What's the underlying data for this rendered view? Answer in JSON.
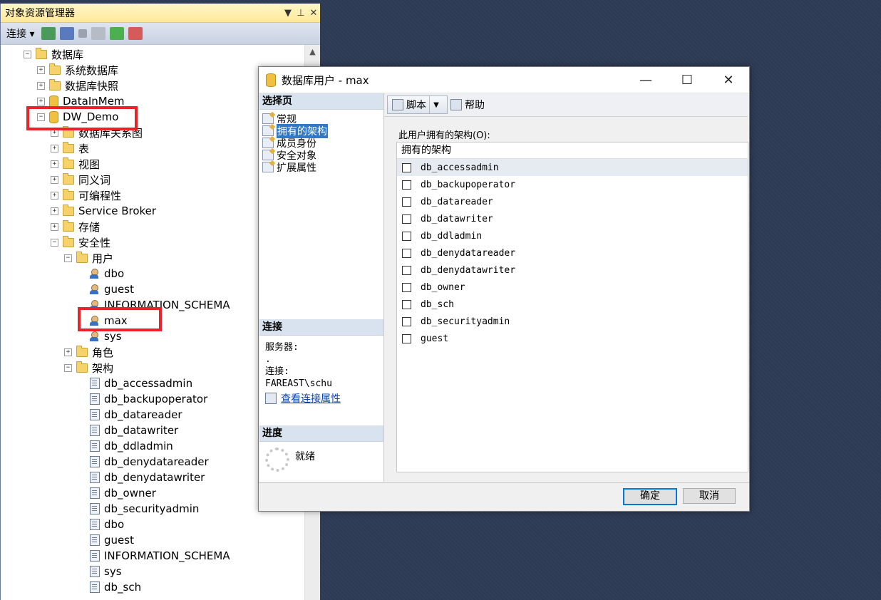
{
  "object_explorer": {
    "title": "对象资源管理器",
    "title_buttons": [
      "▼",
      "⊥",
      "✕"
    ],
    "toolbar": {
      "connect_label": "连接 ▾"
    },
    "tree": [
      {
        "label": "数据库",
        "level": 0,
        "expander": "−",
        "icon": "folder"
      },
      {
        "label": "系统数据库",
        "level": 1,
        "expander": "+",
        "icon": "folder"
      },
      {
        "label": "数据库快照",
        "level": 1,
        "expander": "+",
        "icon": "folder"
      },
      {
        "label": "DataInMem",
        "level": 1,
        "expander": "+",
        "icon": "database"
      },
      {
        "label": "DW_Demo",
        "level": 1,
        "expander": "−",
        "icon": "database"
      },
      {
        "label": "数据库关系图",
        "level": 2,
        "expander": "+",
        "icon": "folder"
      },
      {
        "label": "表",
        "level": 2,
        "expander": "+",
        "icon": "folder"
      },
      {
        "label": "视图",
        "level": 2,
        "expander": "+",
        "icon": "folder"
      },
      {
        "label": "同义词",
        "level": 2,
        "expander": "+",
        "icon": "folder"
      },
      {
        "label": "可编程性",
        "level": 2,
        "expander": "+",
        "icon": "folder"
      },
      {
        "label": "Service Broker",
        "level": 2,
        "expander": "+",
        "icon": "folder"
      },
      {
        "label": "存储",
        "level": 2,
        "expander": "+",
        "icon": "folder"
      },
      {
        "label": "安全性",
        "level": 2,
        "expander": "−",
        "icon": "folder"
      },
      {
        "label": "用户",
        "level": 3,
        "expander": "−",
        "icon": "folder"
      },
      {
        "label": "dbo",
        "level": 4,
        "expander": "",
        "icon": "user"
      },
      {
        "label": "guest",
        "level": 4,
        "expander": "",
        "icon": "user"
      },
      {
        "label": "INFORMATION_SCHEMA",
        "level": 4,
        "expander": "",
        "icon": "user"
      },
      {
        "label": "max",
        "level": 4,
        "expander": "",
        "icon": "user"
      },
      {
        "label": "sys",
        "level": 4,
        "expander": "",
        "icon": "user"
      },
      {
        "label": "角色",
        "level": 3,
        "expander": "+",
        "icon": "folder"
      },
      {
        "label": "架构",
        "level": 3,
        "expander": "−",
        "icon": "folder"
      },
      {
        "label": "db_accessadmin",
        "level": 4,
        "expander": "",
        "icon": "schema"
      },
      {
        "label": "db_backupoperator",
        "level": 4,
        "expander": "",
        "icon": "schema"
      },
      {
        "label": "db_datareader",
        "level": 4,
        "expander": "",
        "icon": "schema"
      },
      {
        "label": "db_datawriter",
        "level": 4,
        "expander": "",
        "icon": "schema"
      },
      {
        "label": "db_ddladmin",
        "level": 4,
        "expander": "",
        "icon": "schema"
      },
      {
        "label": "db_denydatareader",
        "level": 4,
        "expander": "",
        "icon": "schema"
      },
      {
        "label": "db_denydatawriter",
        "level": 4,
        "expander": "",
        "icon": "schema"
      },
      {
        "label": "db_owner",
        "level": 4,
        "expander": "",
        "icon": "schema"
      },
      {
        "label": "db_securityadmin",
        "level": 4,
        "expander": "",
        "icon": "schema"
      },
      {
        "label": "dbo",
        "level": 4,
        "expander": "",
        "icon": "schema"
      },
      {
        "label": "guest",
        "level": 4,
        "expander": "",
        "icon": "schema"
      },
      {
        "label": "INFORMATION_SCHEMA",
        "level": 4,
        "expander": "",
        "icon": "schema"
      },
      {
        "label": "sys",
        "level": 4,
        "expander": "",
        "icon": "schema"
      },
      {
        "label": "db_sch",
        "level": 4,
        "expander": "",
        "icon": "schema"
      }
    ]
  },
  "dialog": {
    "title": "数据库用户 - max",
    "window_buttons": [
      "—",
      "☐",
      "✕"
    ],
    "select_page": {
      "header": "选择页",
      "items": [
        "常规",
        "拥有的架构",
        "成员身份",
        "安全对象",
        "扩展属性"
      ],
      "selected": "拥有的架构"
    },
    "connection": {
      "header": "连接",
      "server_label": "服务器:",
      "server_value": ".",
      "connection_label": "连接:",
      "connection_value": "FAREAST\\schu",
      "link": "查看连接属性"
    },
    "progress": {
      "header": "进度",
      "status": "就绪"
    },
    "toolbar": {
      "script_label": "脚本",
      "help_label": "帮助"
    },
    "owned_schemas": {
      "label": "此用户拥有的架构(O):",
      "column_header": "拥有的架构",
      "items": [
        "db_accessadmin",
        "db_backupoperator",
        "db_datareader",
        "db_datawriter",
        "db_ddladmin",
        "db_denydatareader",
        "db_denydatawriter",
        "db_owner",
        "db_sch",
        "db_securityadmin",
        "guest"
      ]
    },
    "ok_label": "确定",
    "cancel_label": "取消"
  }
}
